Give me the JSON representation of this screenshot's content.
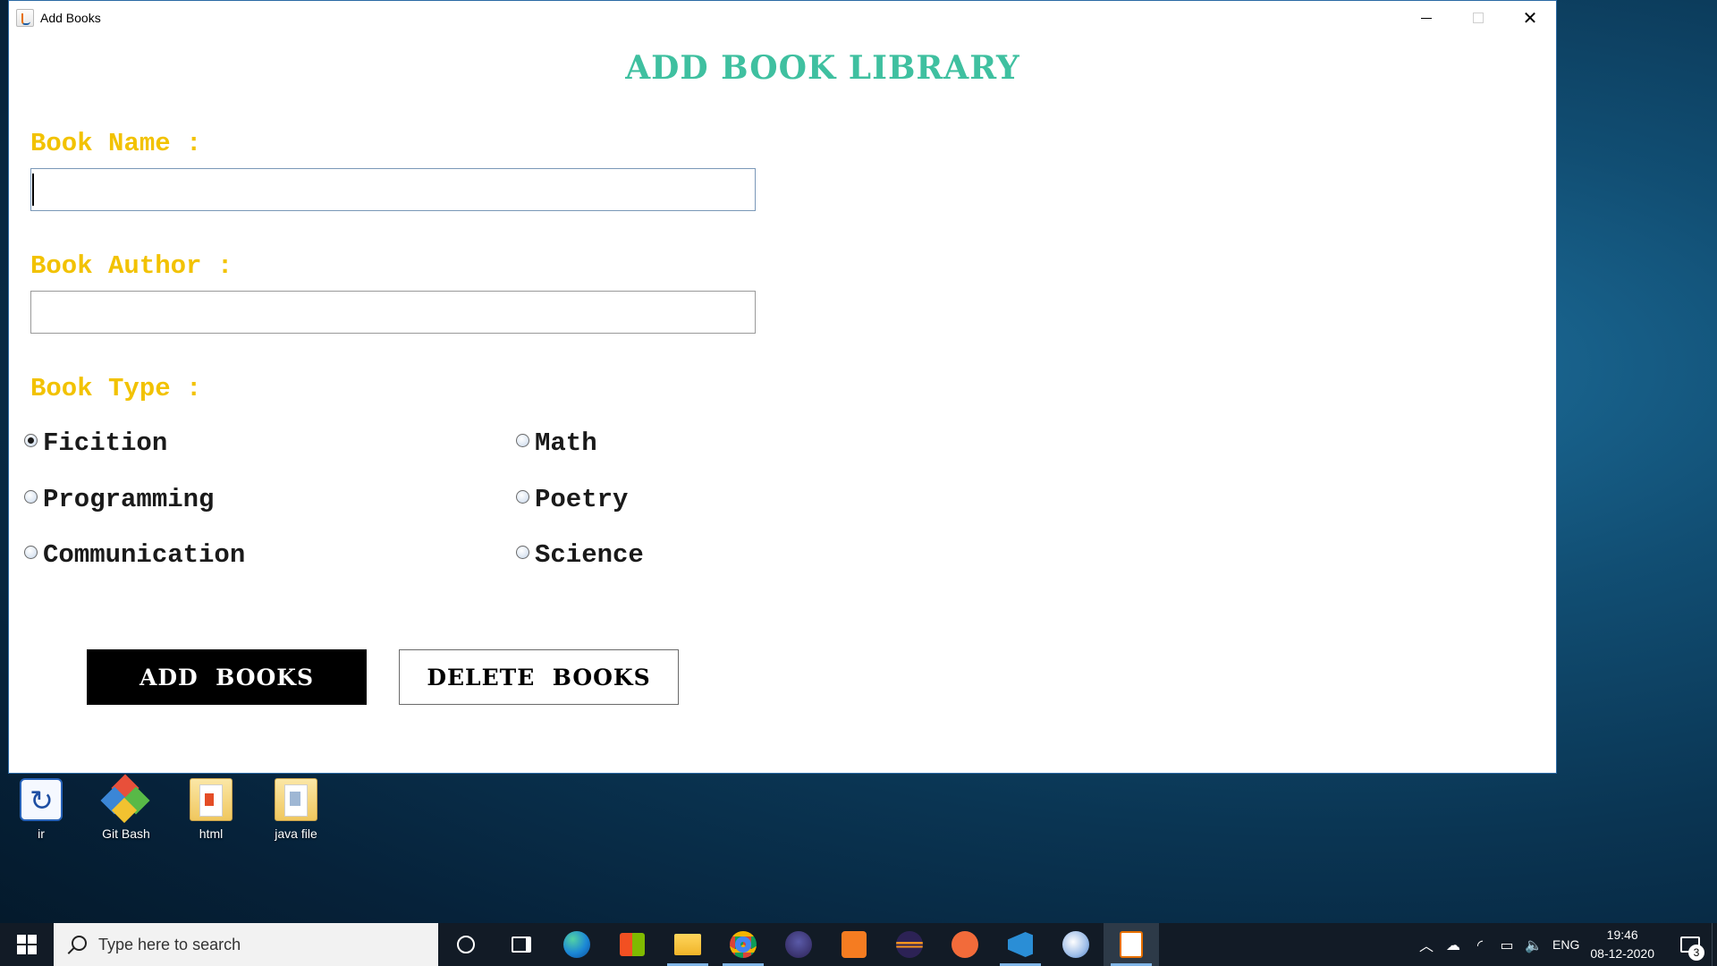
{
  "window": {
    "title": "Add Books",
    "controls": {
      "minimize": "minimize",
      "maximize": "maximize",
      "close": "close"
    }
  },
  "form": {
    "heading": "ADD BOOK LIBRARY",
    "book_name": {
      "label": "Book Name :",
      "value": "",
      "placeholder": ""
    },
    "book_author": {
      "label": "Book Author :",
      "value": "",
      "placeholder": ""
    },
    "book_type": {
      "label": "Book Type :",
      "selected": "Ficition",
      "options": [
        "Ficition",
        "Math",
        "Programming",
        "Poetry",
        "Communication",
        "Science"
      ]
    },
    "buttons": {
      "add": "ADD  BOOKS",
      "delete": "DELETE  BOOKS"
    }
  },
  "desktop": {
    "icons": [
      {
        "label": "ir",
        "icon": "ir-icon"
      },
      {
        "label": "Git Bash",
        "icon": "git-bash-icon"
      },
      {
        "label": "html",
        "icon": "folder-icon"
      },
      {
        "label": "java file",
        "icon": "folder-icon"
      }
    ]
  },
  "taskbar": {
    "search_placeholder": "Type here to search",
    "apps": [
      "cortana",
      "task-view",
      "edge",
      "store",
      "file-explorer",
      "chrome",
      "eclipse",
      "sublime-text",
      "eclipse-ee",
      "postman",
      "vscode",
      "paint",
      "java"
    ],
    "active_app": "java",
    "tray": {
      "language": "ENG",
      "time": "19:46",
      "date": "08-12-2020",
      "notifications": "3"
    }
  },
  "colors": {
    "heading": "#3fc0a0",
    "labels": "#f2c200",
    "add_button_bg": "#000000",
    "desktop": "#0a3553",
    "taskbar": "#121b26"
  }
}
